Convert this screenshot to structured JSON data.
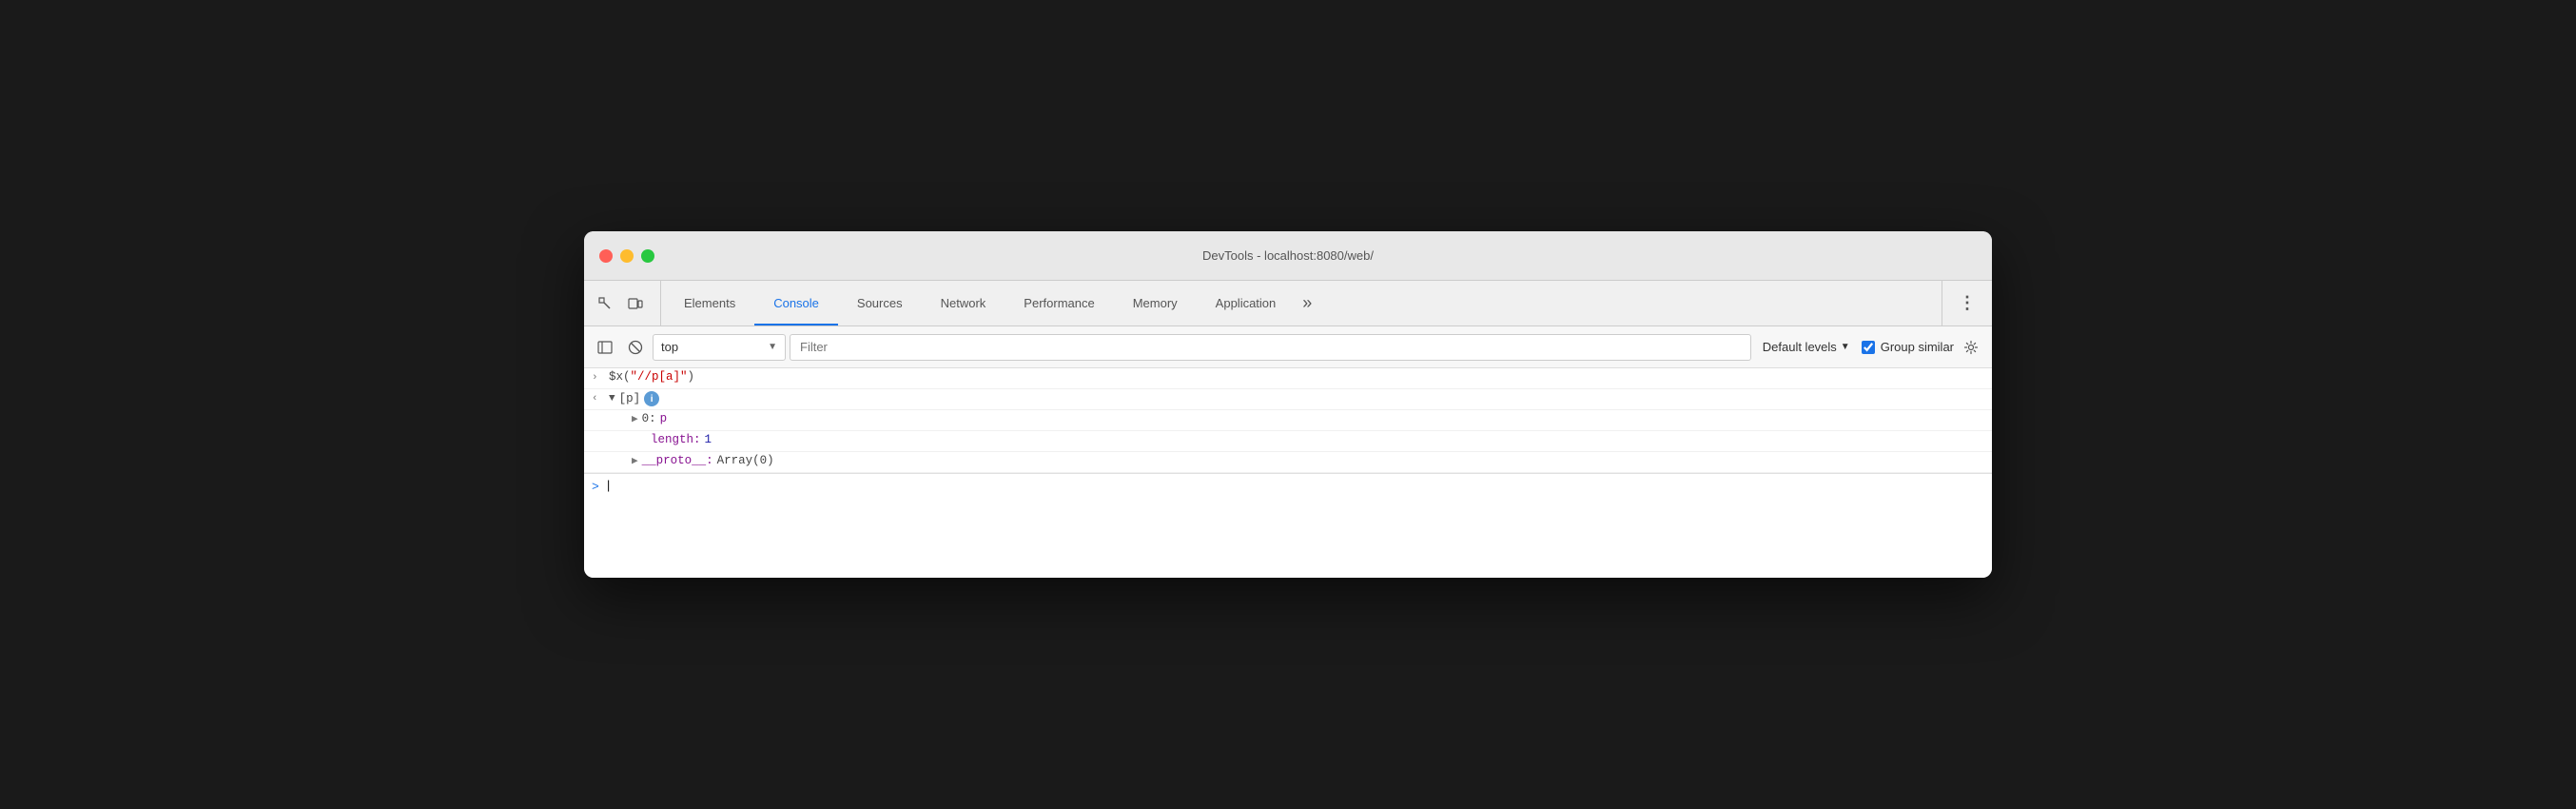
{
  "window": {
    "title": "DevTools - localhost:8080/web/"
  },
  "toolbar": {
    "tabs": [
      {
        "id": "elements",
        "label": "Elements",
        "active": false
      },
      {
        "id": "console",
        "label": "Console",
        "active": true
      },
      {
        "id": "sources",
        "label": "Sources",
        "active": false
      },
      {
        "id": "network",
        "label": "Network",
        "active": false
      },
      {
        "id": "performance",
        "label": "Performance",
        "active": false
      },
      {
        "id": "memory",
        "label": "Memory",
        "active": false
      },
      {
        "id": "application",
        "label": "Application",
        "active": false
      }
    ],
    "more_label": "»",
    "kebab_label": "⋮"
  },
  "console_toolbar": {
    "context_value": "top",
    "filter_placeholder": "Filter",
    "default_levels_label": "Default levels",
    "group_similar_label": "Group similar",
    "group_similar_checked": true
  },
  "console_output": {
    "lines": [
      {
        "type": "input",
        "prefix": ">",
        "content": "$x(\"//p[a]\")"
      },
      {
        "type": "output-back",
        "prefix": "←",
        "content": "▼ [p]",
        "badge": "i"
      },
      {
        "type": "child",
        "indent": 1,
        "content": "▶ 0: p"
      },
      {
        "type": "prop",
        "indent": 2,
        "key": "length:",
        "value": "1"
      },
      {
        "type": "child",
        "indent": 1,
        "content": "▶ __proto__: Array(0)"
      }
    ],
    "cursor_prompt": ">"
  }
}
